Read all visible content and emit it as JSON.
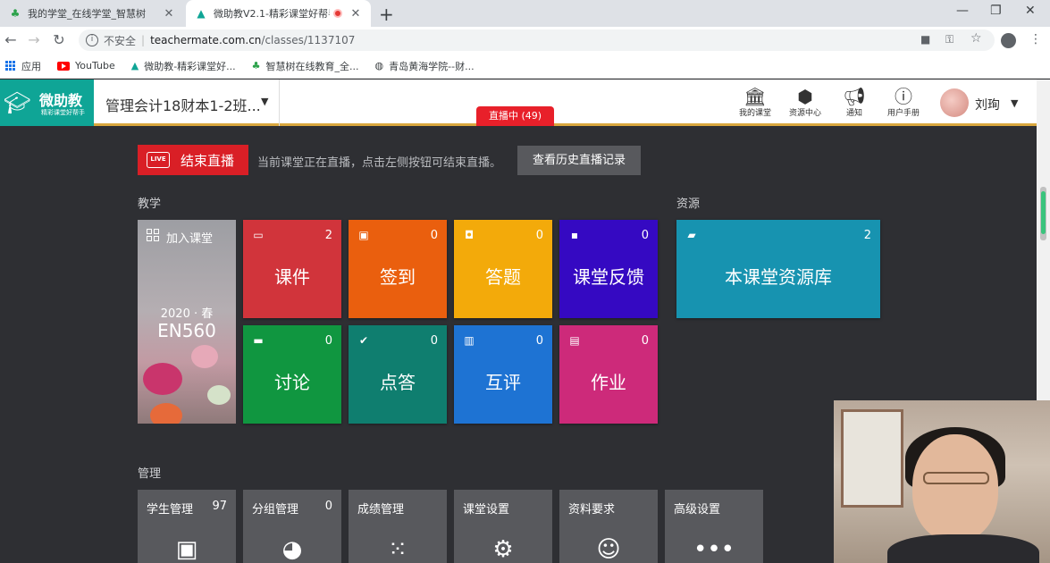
{
  "browser": {
    "tabs": [
      {
        "title": "我的学堂_在线学堂_智慧树",
        "active": false
      },
      {
        "title": "微助教V2.1-精彩课堂好帮手",
        "active": true,
        "recording": true
      }
    ],
    "new_tab": "+",
    "url": {
      "security": "不安全",
      "host": "teachermate.com.cn",
      "path": "/classes/1137107"
    },
    "bookmarks": [
      {
        "label": "应用"
      },
      {
        "label": "YouTube"
      },
      {
        "label": "微助教-精彩课堂好..."
      },
      {
        "label": "智慧树在线教育_全..."
      },
      {
        "label": "青岛黄海学院--财..."
      }
    ]
  },
  "header": {
    "logo_name": "微助教",
    "logo_sub": "精彩课堂好帮手",
    "class_name": "管理会计18财本1-2班...",
    "live_badge": "直播中 (49)",
    "nav": [
      {
        "label": "我的课堂",
        "icon": "classroom-icon"
      },
      {
        "label": "资源中心",
        "icon": "resources-icon"
      },
      {
        "label": "通知",
        "icon": "megaphone-icon"
      },
      {
        "label": "用户手册",
        "icon": "help-icon"
      }
    ],
    "user_name": "刘珣"
  },
  "live": {
    "icon_text": "LIVE",
    "end_button": "结束直播",
    "message": "当前课堂正在直播，点击左侧按钮可结束直播。",
    "history_button": "查看历史直播记录"
  },
  "teaching": {
    "section_label": "教学",
    "class_card": {
      "join_label": "加入课堂",
      "term": "2020 · 春",
      "code": "EN560"
    },
    "tiles": [
      {
        "label": "课件",
        "count": "2",
        "color": "#d1343b",
        "icon": "courseware-icon"
      },
      {
        "label": "签到",
        "count": "0",
        "color": "#ea5f0e",
        "icon": "checkin-icon"
      },
      {
        "label": "答题",
        "count": "0",
        "color": "#f3aa0a",
        "icon": "quiz-icon"
      },
      {
        "label": "课堂反馈",
        "count": "0",
        "color": "#3509c2",
        "icon": "feedback-icon"
      },
      {
        "label": "讨论",
        "count": "0",
        "color": "#109640",
        "icon": "discussion-icon"
      },
      {
        "label": "点答",
        "count": "0",
        "color": "#0f7e6f",
        "icon": "pick-answer-icon"
      },
      {
        "label": "互评",
        "count": "0",
        "color": "#1e73d3",
        "icon": "peer-review-icon"
      },
      {
        "label": "作业",
        "count": "0",
        "color": "#cd2a7a",
        "icon": "homework-icon"
      }
    ]
  },
  "resources": {
    "section_label": "资源",
    "tile": {
      "label": "本课堂资源库",
      "count": "2",
      "color": "#1793b0",
      "icon": "resource-folder-icon"
    }
  },
  "management": {
    "section_label": "管理",
    "tiles": [
      {
        "label": "学生管理",
        "count": "97",
        "icon": "student-card-icon"
      },
      {
        "label": "分组管理",
        "count": "0",
        "icon": "group-icon"
      },
      {
        "label": "成绩管理",
        "count": "",
        "icon": "grid-icon"
      },
      {
        "label": "课堂设置",
        "count": "",
        "icon": "gear-icon"
      },
      {
        "label": "资料要求",
        "count": "",
        "icon": "face-icon"
      },
      {
        "label": "高级设置",
        "count": "",
        "icon": "more-icon"
      }
    ]
  }
}
